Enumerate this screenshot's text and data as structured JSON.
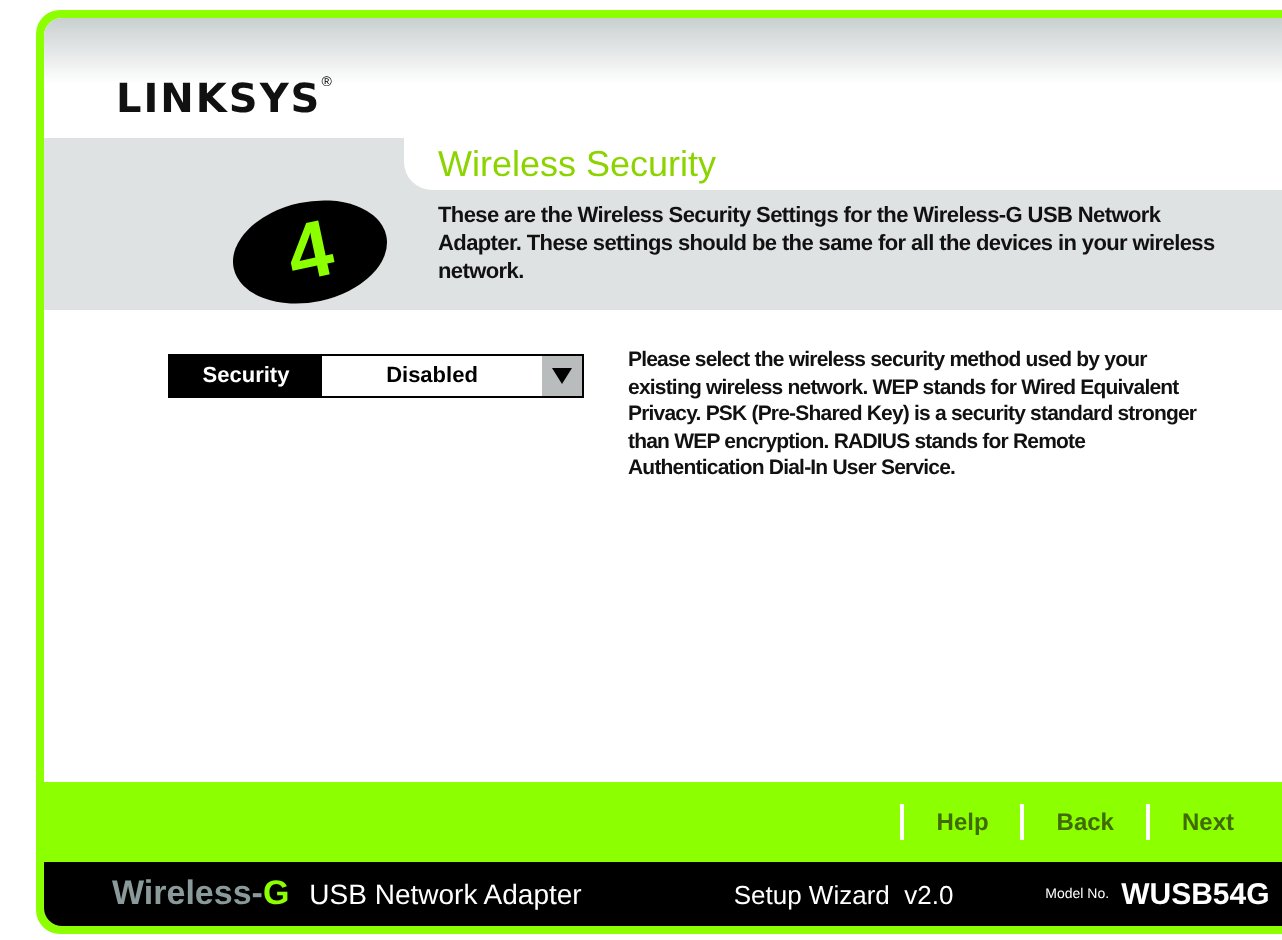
{
  "logo": "LINKSYS",
  "logo_mark": "®",
  "step": "4",
  "title": "Wireless Security",
  "intro": "These are the Wireless Security Settings for the Wireless-G USB Network Adapter. These settings should be the same for all the devices in your wireless network.",
  "security": {
    "label": "Security",
    "value": "Disabled"
  },
  "help_text": "Please select the wireless security method used by your existing wireless network. WEP stands for Wired Equivalent Privacy. PSK (Pre-Shared Key) is a security standard stronger than WEP encryption. RADIUS stands for Remote Authentication Dial-In User Service.",
  "buttons": [
    {
      "label": "Help",
      "disabled": true
    },
    {
      "label": "Back",
      "disabled": true
    },
    {
      "label": "Next",
      "disabled": true
    }
  ],
  "footer": {
    "product_brand": "Wireless-",
    "product_letter": "G",
    "product_name": "USB Network Adapter",
    "wizard": "Setup Wizard  v2.0",
    "model_label": "Model No.",
    "model": "WUSB54G"
  }
}
